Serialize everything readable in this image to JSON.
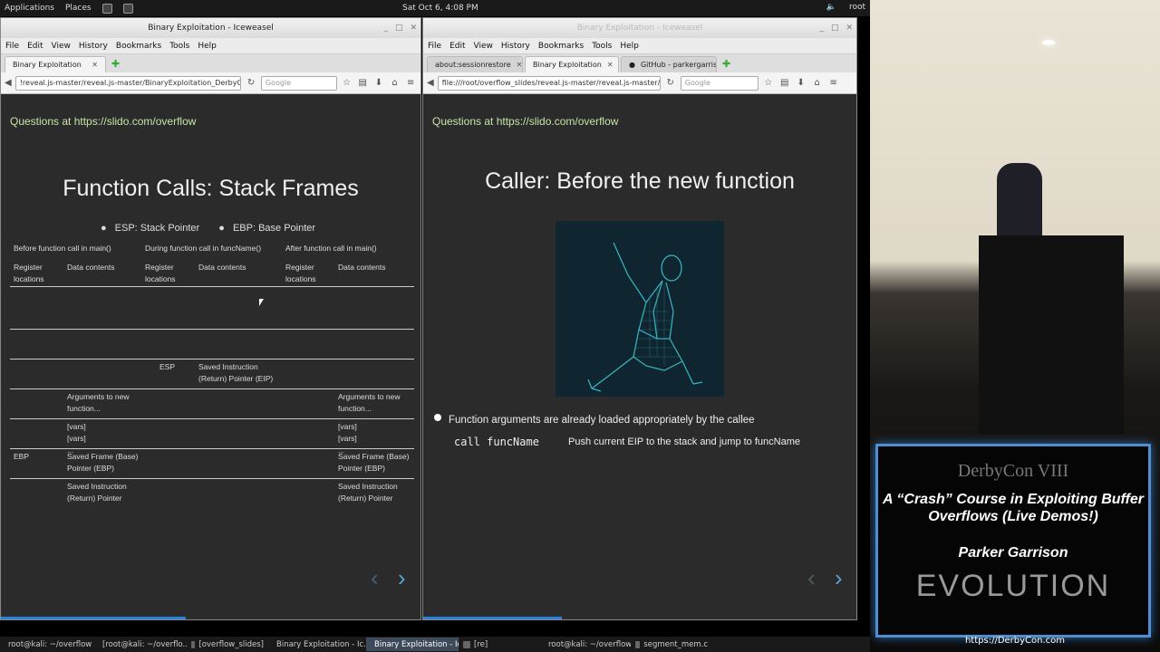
{
  "desktop": {
    "menu": [
      "Applications",
      "Places"
    ],
    "clock": "Sat Oct 6, 4:08 PM",
    "user": "root"
  },
  "left_window": {
    "title": "Binary Exploitation - Iceweasel",
    "menus": [
      "File",
      "Edit",
      "View",
      "History",
      "Bookmarks",
      "Tools",
      "Help"
    ],
    "tabs": [
      {
        "label": "Binary Exploitation"
      }
    ],
    "url": "!reveal.js-master/reveal.js-master/BinaryExploitation_DerbyCon.html#",
    "search_placeholder": "Google",
    "slide": {
      "question_line": "Questions at https://slido.com/overflow",
      "title": "Function Calls: Stack Frames",
      "bullets": [
        "ESP: Stack Pointer",
        "EBP: Base Pointer"
      ],
      "table": {
        "group_headers": [
          "Before function call in main()",
          "During function call in funcName()",
          "After function call in main()"
        ],
        "sub_headers": [
          "Register locations",
          "Data contents"
        ],
        "rows": [
          {
            "a_reg": "",
            "a_data": "",
            "b_reg": "",
            "b_data": "",
            "c_reg": "",
            "c_data": ""
          },
          {
            "a_reg": "",
            "a_data": "",
            "b_reg": "",
            "b_data": "",
            "c_reg": "",
            "c_data": ""
          },
          {
            "a_reg": "",
            "a_data": "",
            "b_reg": "ESP",
            "b_data": "Saved Instruction (Return) Pointer (EIP)",
            "c_reg": "",
            "c_data": ""
          },
          {
            "a_reg": "",
            "a_data": "Arguments to new function...",
            "b_reg": "",
            "b_data": "",
            "c_reg": "",
            "c_data": "Arguments to new function..."
          },
          {
            "a_reg": "",
            "a_data": "[vars]\n[vars]\n...",
            "b_reg": "",
            "b_data": "",
            "c_reg": "",
            "c_data": "[vars]\n[vars]\n..."
          },
          {
            "a_reg": "EBP",
            "a_data": "Saved Frame (Base) Pointer (EBP)",
            "b_reg": "",
            "b_data": "",
            "c_reg": "",
            "c_data": "Saved Frame (Base) Pointer (EBP)"
          },
          {
            "a_reg": "",
            "a_data": "Saved Instruction (Return) Pointer",
            "b_reg": "",
            "b_data": "",
            "c_reg": "",
            "c_data": "Saved Instruction (Return) Pointer"
          }
        ]
      }
    }
  },
  "right_window": {
    "title": "Binary Exploitation - Iceweasel",
    "menus": [
      "File",
      "Edit",
      "View",
      "History",
      "Bookmarks",
      "Tools",
      "Help"
    ],
    "tabs": [
      {
        "label": "about:sessionrestore"
      },
      {
        "label": "Binary Exploitation"
      },
      {
        "label": "GitHub - parkergarris..."
      }
    ],
    "url": "file:///root/overflow_slides/reveal.js-master/reveal.js-master/BinaryExploi",
    "search_placeholder": "Google",
    "slide": {
      "question_line": "Questions at https://slido.com/overflow",
      "title": "Caller: Before the new function",
      "bullet": "Function arguments are already loaded appropriately by the callee",
      "code": "call funcName",
      "code_desc": "Push current EIP to the stack and jump to funcName"
    }
  },
  "camera": {
    "brand": "DerbyCon VIII",
    "talk_title": "A “Crash” Course in Exploiting Buffer Overflows (Live Demos!)",
    "speaker": "Parker Garrison",
    "theme": "EVOLUTION",
    "site": "https://DerbyCon.com"
  },
  "taskbar": [
    {
      "label": "root@kali: ~/overflow",
      "active": false
    },
    {
      "label": "[root@kali: ~/overflo...",
      "active": false
    },
    {
      "label": "[overflow_slides]",
      "active": false
    },
    {
      "label": "Binary Exploitation - Ic...",
      "active": false
    },
    {
      "label": "Binary Exploitation - Ic...",
      "active": true
    },
    {
      "label": "[re]",
      "active": false
    },
    {
      "label": "root@kali: ~/overflow",
      "active": false
    },
    {
      "label": "segment_mem.c",
      "active": false
    }
  ],
  "colors": {
    "accent": "#2a82da",
    "slide_bg": "#2b2b2b",
    "question_text": "#c6e5a8",
    "banner_border": "#4f8fd0"
  }
}
